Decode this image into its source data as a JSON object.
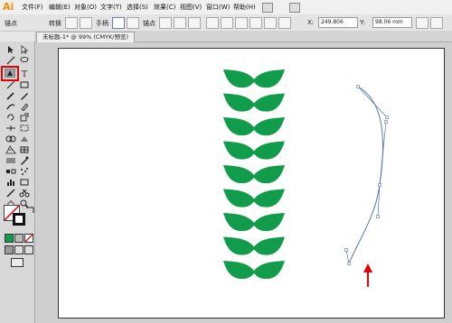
{
  "app": {
    "logo_text": "Ai"
  },
  "menubar": {
    "items": [
      "文件(F)",
      "编辑(E)",
      "对象(O)",
      "文字(T)",
      "选择(S)",
      "效果(C)",
      "视图(V)",
      "窗口(W)",
      "帮助(H)"
    ]
  },
  "options_bar": {
    "anchor_label": "锚点",
    "convert_label": "转换",
    "handle_label": "手柄",
    "anchor_label2": "锚点",
    "x_value": "249.806",
    "y_value": "98.06 mm"
  },
  "document": {
    "tab_label": "未标题-1* @ 99% (CMYK/预览)"
  },
  "colors": {
    "leaf": "#119c4b",
    "path": "#5577aa",
    "arrow": "#e60000",
    "highlight": "#e60000"
  },
  "leaves": {
    "count": 9
  }
}
